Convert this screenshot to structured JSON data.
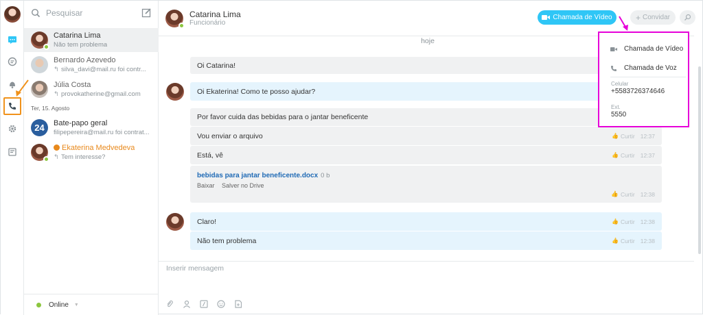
{
  "colors": {
    "accent": "#2fc6f6",
    "online": "#8cc63f",
    "highlight_orange": "#f0921b",
    "highlight_magenta": "#e600d9",
    "link": "#1f6ab5"
  },
  "rail": {
    "icons": [
      "chat-icon",
      "channels-icon",
      "bell-icon",
      "phone-icon",
      "gear-icon",
      "notes-icon"
    ]
  },
  "sidebar": {
    "search_placeholder": "Pesquisar",
    "date_separator": "Ter, 15. Agosto",
    "status_label": "Online",
    "items": [
      {
        "name": "Catarina Lima",
        "preview": "Não tem problema"
      },
      {
        "name": "Bernardo Azevedo",
        "preview": "silva_davi@mail.ru foi contr..."
      },
      {
        "name": "Júlia Costa",
        "preview": "provokatherine@gmail.com"
      },
      {
        "name": "Bate-papo geral",
        "preview": "filipepereira@mail.ru foi contrat...",
        "badge": "24"
      },
      {
        "name": "Ekaterina Medvedeva",
        "preview": "Tem interesse?"
      }
    ]
  },
  "chat": {
    "name": "Catarina Lima",
    "role": "Funcionário",
    "video_button": "Chamada de Vídeo",
    "invite_button": "Convidar",
    "day_label": "hoje",
    "input_placeholder": "Inserir mensagem",
    "like_label": "Curtir",
    "messages": [
      {
        "text": "Oi Catarina!"
      },
      {
        "text": "Oi Ekaterina! Como te posso ajudar?"
      },
      {
        "text": "Por favor cuida das bebidas para o jantar beneficente"
      },
      {
        "text": "Vou enviar o arquivo",
        "time": "12:37"
      },
      {
        "text": "Está, vê",
        "time": "12:37"
      },
      {
        "text": "Claro!",
        "time": "12:38"
      },
      {
        "text": "Não tem problema",
        "time": "12:38"
      }
    ],
    "file": {
      "name": "bebidas para jantar beneficente.docx",
      "size": "0 b",
      "download": "Baixar",
      "save": "Salver no Drive",
      "time": "12:38"
    }
  },
  "popup": {
    "video_call": "Chamada de Vídeo",
    "voice_call": "Chamada de Voz",
    "mobile_label": "Celular",
    "mobile_value": "+5583726374646",
    "ext_label": "Ext.",
    "ext_value": "5550"
  }
}
